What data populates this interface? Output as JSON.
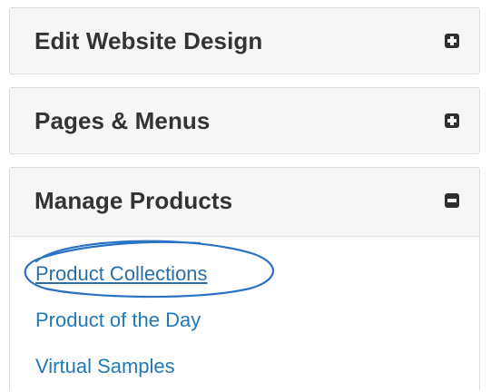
{
  "accordion": {
    "panels": [
      {
        "title": "Edit Website Design",
        "toggle_icon": "plus-square-icon",
        "expanded": false
      },
      {
        "title": "Pages & Menus",
        "toggle_icon": "plus-square-icon",
        "expanded": false
      },
      {
        "title": "Manage Products",
        "toggle_icon": "minus-square-icon",
        "expanded": true,
        "links": [
          {
            "label": "Product Collections",
            "highlighted": true
          },
          {
            "label": "Product of the Day",
            "highlighted": false
          },
          {
            "label": "Virtual Samples",
            "highlighted": false
          }
        ]
      }
    ]
  },
  "colors": {
    "panel_background": "#f6f6f6",
    "panel_border": "#dedede",
    "heading_text": "#333333",
    "link": "#1f7ab8",
    "annotation_circle": "#2b72c4"
  }
}
